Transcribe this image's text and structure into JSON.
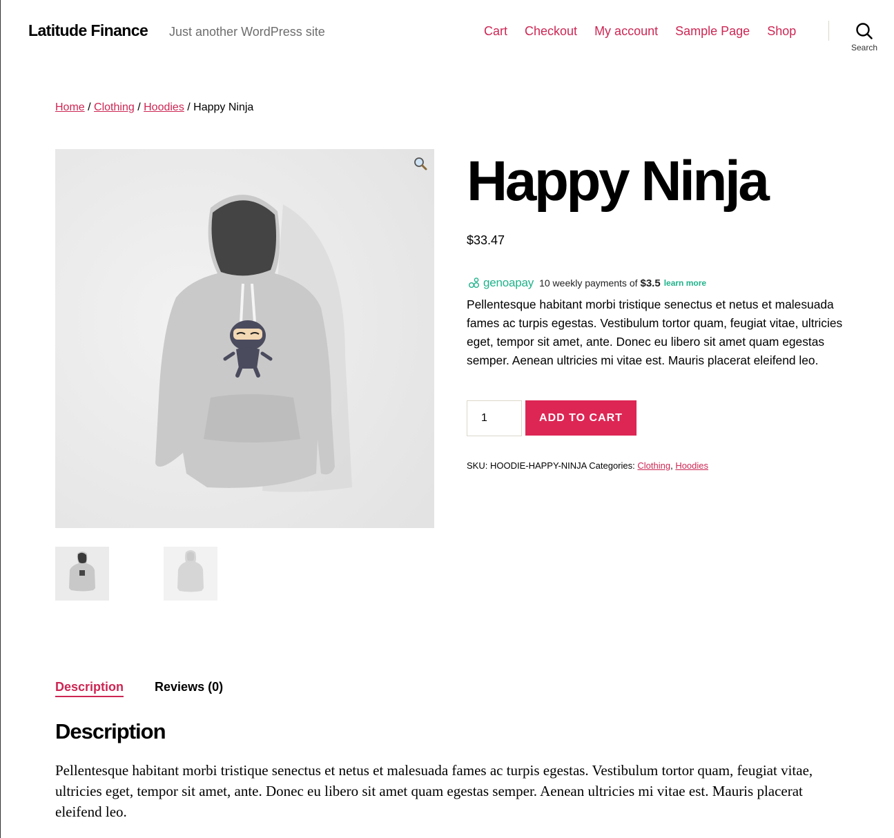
{
  "header": {
    "site_title": "Latitude Finance",
    "site_description": "Just another WordPress site",
    "nav": [
      {
        "label": "Cart"
      },
      {
        "label": "Checkout"
      },
      {
        "label": "My account"
      },
      {
        "label": "Sample Page"
      },
      {
        "label": "Shop"
      }
    ],
    "search_label": "Search"
  },
  "breadcrumb": {
    "items": [
      {
        "label": "Home"
      },
      {
        "label": "Clothing"
      },
      {
        "label": "Hoodies"
      }
    ],
    "separator": "/",
    "current": "Happy Ninja"
  },
  "product": {
    "title": "Happy Ninja",
    "price": "$33.47",
    "genoapay": {
      "brand": "genoapay",
      "text": "10 weekly payments of",
      "amount": "$3.5",
      "learn_more": "learn more"
    },
    "short_description": "Pellentesque habitant morbi tristique senectus et netus et malesuada fames ac turpis egestas. Vestibulum tortor quam, feugiat vitae, ultricies eget, tempor sit amet, ante. Donec eu libero sit amet quam egestas semper. Aenean ultricies mi vitae est. Mauris placerat eleifend leo.",
    "quantity": "1",
    "add_to_cart": "ADD TO CART",
    "meta": {
      "sku_label": "SKU:",
      "sku": "HOODIE-HAPPY-NINJA",
      "categories_label": "Categories:",
      "categories": [
        "Clothing",
        "Hoodies"
      ]
    }
  },
  "tabs": [
    {
      "label": "Description"
    },
    {
      "label": "Reviews (0)"
    }
  ],
  "description": {
    "heading": "Description",
    "body": "Pellentesque habitant morbi tristique senectus et netus et malesuada fames ac turpis egestas. Vestibulum tortor quam, feugiat vitae, ultricies eget, tempor sit amet, ante. Donec eu libero sit amet quam egestas semper. Aenean ultricies mi vitae est. Mauris placerat eleifend leo."
  },
  "colors": {
    "accent": "#cd2653",
    "button": "#dd2654",
    "genoapay": "#1fb28a",
    "image_bg": "#ececec"
  },
  "icons": [
    "search-icon",
    "zoom-icon",
    "genoapay-logo-icon"
  ]
}
